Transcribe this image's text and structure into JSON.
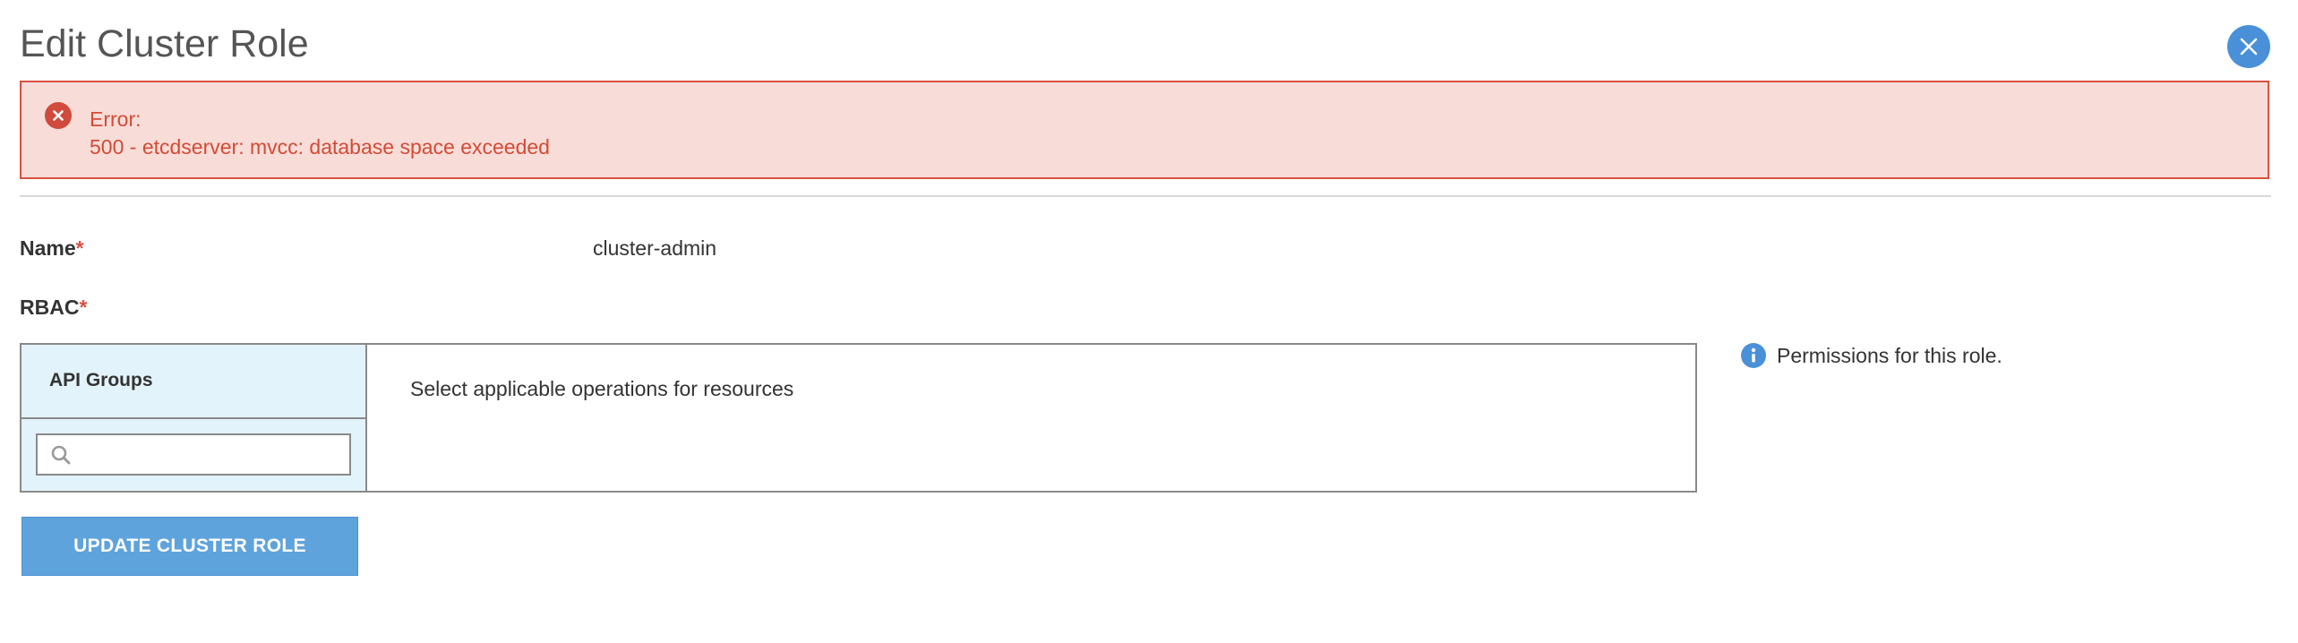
{
  "modal": {
    "title": "Edit Cluster Role",
    "close_icon": "close-icon",
    "accent_color": "#4a90d9"
  },
  "error": {
    "icon": "error-circle-icon",
    "label": "Error:",
    "message": "500 - etcdserver: mvcc: database space exceeded",
    "background_color": "#f8dcd8",
    "border_color": "#d9503f",
    "text_color": "#d34b35"
  },
  "form": {
    "name": {
      "label": "Name",
      "required_marker": "*",
      "value": "cluster-admin"
    },
    "rbac": {
      "label": "RBAC",
      "required_marker": "*",
      "api_groups": {
        "header": "API Groups",
        "search_icon": "search-icon",
        "search_value": "",
        "search_placeholder": ""
      },
      "operations_hint": "Select applicable operations for resources"
    },
    "info": {
      "icon": "info-icon",
      "text": "Permissions for this role."
    },
    "submit": {
      "label": "UPDATE CLUSTER ROLE",
      "color": "#5fa3dc"
    }
  }
}
